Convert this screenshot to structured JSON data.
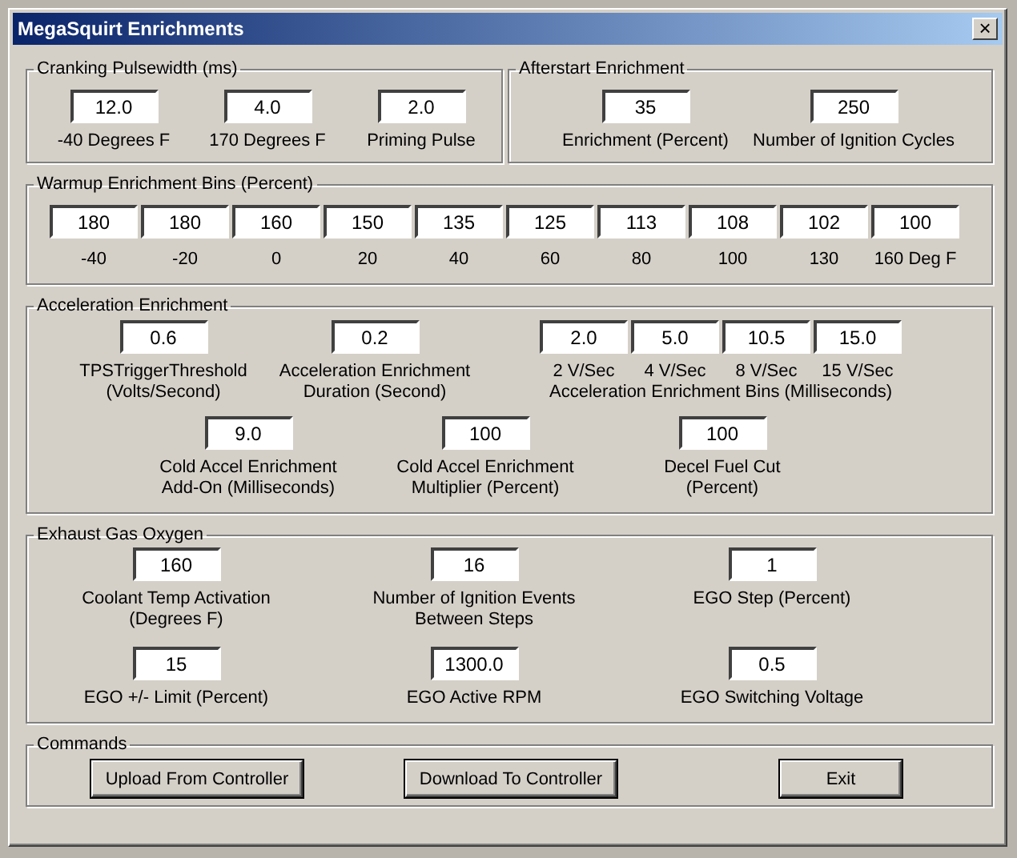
{
  "window": {
    "title": "MegaSquirt Enrichments",
    "close": "×"
  },
  "cranking": {
    "title": "Cranking Pulsewidth (ms)",
    "fields": [
      {
        "value": "12.0",
        "label": "-40 Degrees F"
      },
      {
        "value": "4.0",
        "label": "170 Degrees F"
      },
      {
        "value": "2.0",
        "label": "Priming Pulse"
      }
    ]
  },
  "afterstart": {
    "title": "Afterstart Enrichment",
    "fields": [
      {
        "value": "35",
        "label": "Enrichment (Percent)"
      },
      {
        "value": "250",
        "label": "Number of Ignition Cycles"
      }
    ]
  },
  "warmup": {
    "title": "Warmup Enrichment Bins (Percent)",
    "bins": [
      {
        "value": "180",
        "label": "-40"
      },
      {
        "value": "180",
        "label": "-20"
      },
      {
        "value": "160",
        "label": "0"
      },
      {
        "value": "150",
        "label": "20"
      },
      {
        "value": "135",
        "label": "40"
      },
      {
        "value": "125",
        "label": "60"
      },
      {
        "value": "113",
        "label": "80"
      },
      {
        "value": "108",
        "label": "100"
      },
      {
        "value": "102",
        "label": "130"
      },
      {
        "value": "100",
        "label": "160 Deg F"
      }
    ]
  },
  "acceleration": {
    "title": "Acceleration Enrichment",
    "fields": [
      {
        "value": "0.6",
        "label": "TPSTriggerThreshold\n(Volts/Second)"
      },
      {
        "value": "0.2",
        "label": "Acceleration Enrichment\nDuration (Second)"
      }
    ],
    "bins": {
      "caption": "Acceleration Enrichment Bins (Milliseconds)",
      "items": [
        {
          "value": "2.0",
          "label": "2 V/Sec"
        },
        {
          "value": "5.0",
          "label": "4 V/Sec"
        },
        {
          "value": "10.5",
          "label": "8 V/Sec"
        },
        {
          "value": "15.0",
          "label": "15 V/Sec"
        }
      ]
    },
    "fields_row_2": [
      {
        "value": "9.0",
        "label": "Cold Accel Enrichment\nAdd-On (Milliseconds)"
      },
      {
        "value": "100",
        "label": "Cold Accel Enrichment\nMultiplier (Percent)"
      },
      {
        "value": "100",
        "label": "Decel Fuel Cut\n(Percent)"
      }
    ]
  },
  "ego": {
    "title": "Exhaust Gas Oxygen",
    "rows": [
      [
        {
          "value": "160",
          "label": "Coolant Temp Activation\n(Degrees F)"
        },
        {
          "value": "16",
          "label": "Number of Ignition Events\nBetween Steps"
        },
        {
          "value": "1",
          "label": "EGO Step (Percent)"
        }
      ],
      [
        {
          "value": "15",
          "label": "EGO +/- Limit (Percent)"
        },
        {
          "value": "1300.0",
          "label": "EGO Active RPM"
        },
        {
          "value": "0.5",
          "label": "EGO Switching Voltage"
        }
      ]
    ]
  },
  "commands": {
    "title": "Commands",
    "buttons": [
      "Upload From Controller",
      "Download To Controller",
      "Exit"
    ]
  }
}
